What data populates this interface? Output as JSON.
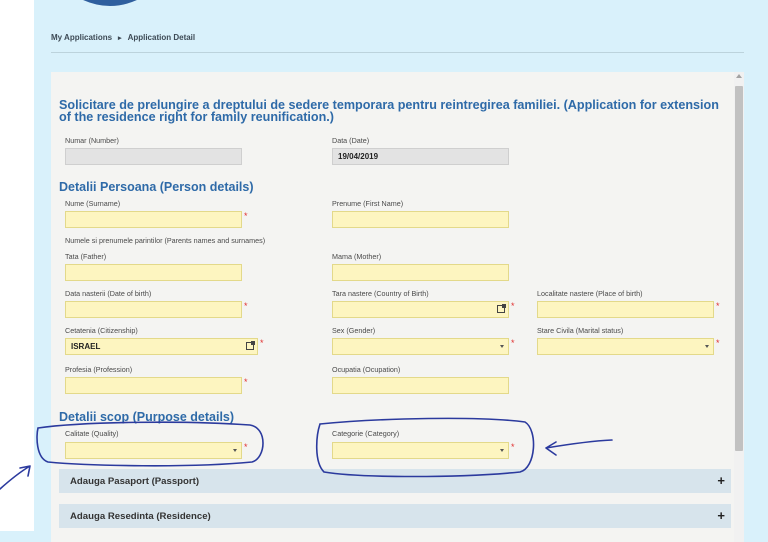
{
  "breadcrumb": {
    "items": [
      "My Applications",
      "Application Detail"
    ]
  },
  "form": {
    "title": "Solicitare de prelungire a dreptului de sedere temporara pentru reintregirea familiei. (Application for extension of the residence right for family reunification.)",
    "number": {
      "label": "Numar (Number)",
      "value": ""
    },
    "date": {
      "label": "Data (Date)",
      "value": "19/04/2019"
    },
    "person_section": "Detalii Persoana (Person details)",
    "surname": {
      "label": "Nume (Surname)",
      "value": ""
    },
    "first_name": {
      "label": "Prenume (First Name)",
      "value": ""
    },
    "parents_note": "Numele si prenumele parintilor (Parents names and surnames)",
    "father": {
      "label": "Tata (Father)",
      "value": ""
    },
    "mother": {
      "label": "Mama (Mother)",
      "value": ""
    },
    "dob": {
      "label": "Data nasterii (Date of birth)",
      "value": ""
    },
    "country_birth": {
      "label": "Tara nastere (Country of Birth)",
      "value": ""
    },
    "place_birth": {
      "label": "Localitate nastere (Place of birth)",
      "value": ""
    },
    "citizenship": {
      "label": "Cetatenia (Citizenship)",
      "value": "ISRAEL"
    },
    "gender": {
      "label": "Sex (Gender)",
      "value": ""
    },
    "marital": {
      "label": "Stare Civila (Marital status)",
      "value": ""
    },
    "profession": {
      "label": "Profesia (Profession)",
      "value": ""
    },
    "occupation": {
      "label": "Ocupatia (Ocupation)",
      "value": ""
    },
    "purpose_section": "Detalii scop (Purpose details)",
    "quality": {
      "label": "Calitate (Quality)",
      "value": ""
    },
    "category": {
      "label": "Categorie (Category)",
      "value": ""
    },
    "accordions": [
      "Adauga Pasaport (Passport)",
      "Adauga Resedinta (Residence)"
    ],
    "required_mark": "*"
  },
  "colors": {
    "accent": "#2e6aa8",
    "field_bg": "#fdf5c0",
    "panel_bg": "#d9f1fb",
    "annotation": "#2b3a9e"
  }
}
